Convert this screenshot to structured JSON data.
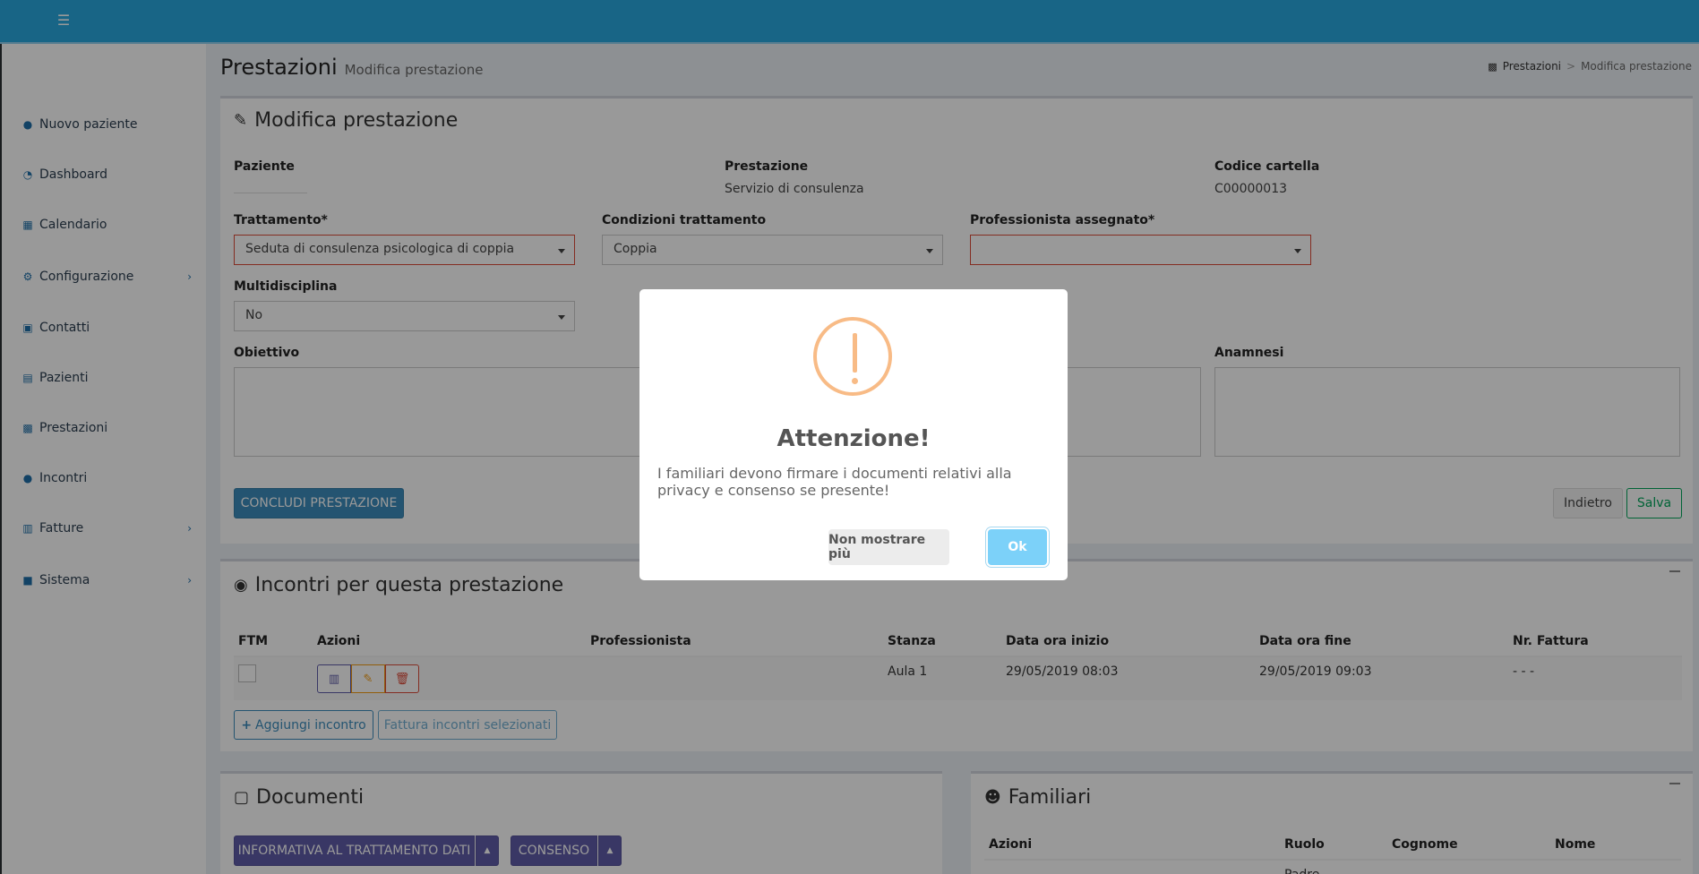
{
  "topbar": {
    "menu_icon": "bars-icon"
  },
  "sidebar": {
    "items": [
      {
        "label": "Nuovo paziente",
        "icon": "user-icon",
        "has_submenu": false
      },
      {
        "label": "Dashboard",
        "icon": "dashboard-icon",
        "has_submenu": false
      },
      {
        "label": "Calendario",
        "icon": "calendar-icon",
        "has_submenu": false
      },
      {
        "label": "Configurazione",
        "icon": "gears-icon",
        "has_submenu": true
      },
      {
        "label": "Contatti",
        "icon": "address-book-icon",
        "has_submenu": false
      },
      {
        "label": "Pazienti",
        "icon": "id-card-icon",
        "has_submenu": false
      },
      {
        "label": "Prestazioni",
        "icon": "book-icon",
        "has_submenu": false
      },
      {
        "label": "Incontri",
        "icon": "comments-icon",
        "has_submenu": false
      },
      {
        "label": "Fatture",
        "icon": "invoice-icon",
        "has_submenu": true
      },
      {
        "label": "Sistema",
        "icon": "briefcase-icon",
        "has_submenu": true
      }
    ]
  },
  "header": {
    "title": "Prestazioni",
    "subtitle": "Modifica prestazione",
    "breadcrumb": {
      "root": "Prestazioni",
      "current": "Modifica prestazione"
    }
  },
  "edit_box": {
    "title": "Modifica prestazione",
    "paziente_label": "Paziente",
    "prestazione_label": "Prestazione",
    "prestazione_value": "Servizio di consulenza",
    "codice_label": "Codice cartella",
    "codice_value": "C00000013",
    "trattamento_label": "Trattamento*",
    "trattamento_value": "Seduta di consulenza psicologica di coppia",
    "condizioni_label": "Condizioni trattamento",
    "condizioni_value": "Coppia",
    "professionista_label": "Professionista assegnato*",
    "professionista_value": "",
    "multidisciplina_label": "Multidisciplina",
    "multidisciplina_value": "No",
    "obiettivo_label": "Obiettivo",
    "anamnesi_label": "Anamnesi",
    "concludi_label": "CONCLUDI PRESTAZIONE",
    "indietro_label": "Indietro",
    "salva_label": "Salva"
  },
  "incontri_box": {
    "title": "Incontri per questa prestazione",
    "columns": [
      "FTM",
      "Azioni",
      "Professionista",
      "Stanza",
      "Data ora inizio",
      "Data ora fine",
      "Nr. Fattura"
    ],
    "rows": [
      {
        "professionista": "",
        "stanza": "Aula 1",
        "inizio": "29/05/2019 08:03",
        "fine": "29/05/2019 09:03",
        "fattura": "- - -"
      }
    ],
    "aggiungi_label": "Aggiungi incontro",
    "fattura_label": "Fattura incontri selezionati"
  },
  "documenti_box": {
    "title": "Documenti",
    "btn_informativa": "INFORMATIVA AL TRATTAMENTO DATI",
    "btn_consenso": "CONSENSO"
  },
  "familiari_box": {
    "title": "Familiari",
    "columns": [
      "Azioni",
      "Ruolo",
      "Cognome",
      "Nome"
    ],
    "partial_row_ruolo": "Padre"
  },
  "modal": {
    "icon": "warning-icon",
    "title": "Attenzione!",
    "text": "I familiari devono firmare i documenti relativi alla privacy e consenso se presente!",
    "cancel_label": "Non mostrare più",
    "ok_label": "Ok"
  },
  "colors": {
    "topbar": "#29a8e0",
    "primary": "#3c8dbc",
    "error": "#dd4b39",
    "warning_icon": "#f8bb86",
    "ok_button": "#7cd1f9",
    "purple": "#605ca8"
  }
}
